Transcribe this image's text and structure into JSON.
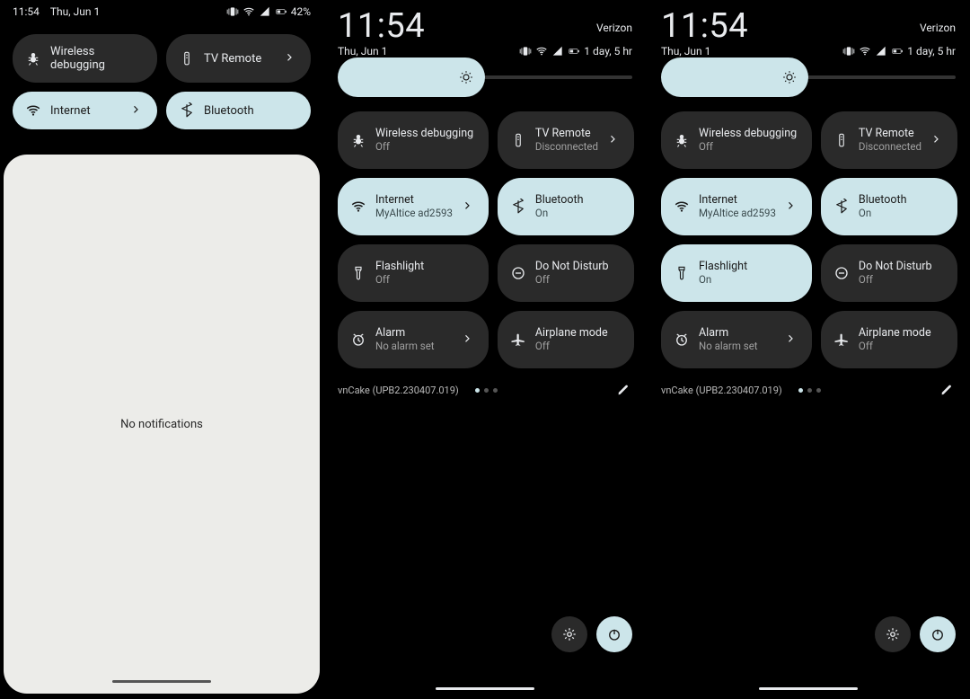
{
  "phone1": {
    "status": {
      "time": "11:54",
      "date": "Thu, Jun 1",
      "battery_percent": "42%"
    },
    "tiles": [
      {
        "id": "wireless-debugging",
        "label": "Wireless debugging",
        "style": "dark",
        "chevron": false
      },
      {
        "id": "tv-remote",
        "label": "TV Remote",
        "style": "dark",
        "chevron": true
      },
      {
        "id": "internet",
        "label": "Internet",
        "style": "accent",
        "chevron": true
      },
      {
        "id": "bluetooth",
        "label": "Bluetooth",
        "style": "accent",
        "chevron": false
      }
    ],
    "panel_text": "No notifications"
  },
  "phone2": {
    "time": "11:54",
    "carrier": "Verizon",
    "date": "Thu, Jun 1",
    "battery_note": "1 day, 5 hr",
    "tiles": [
      {
        "id": "wireless-debugging",
        "label": "Wireless debugging",
        "sub": "Off",
        "style": "dark",
        "chevron": false
      },
      {
        "id": "tv-remote",
        "label": "TV Remote",
        "sub": "Disconnected",
        "style": "dark",
        "chevron": true
      },
      {
        "id": "internet",
        "label": "Internet",
        "sub": "MyAltice ad2593",
        "style": "accent",
        "chevron": true
      },
      {
        "id": "bluetooth",
        "label": "Bluetooth",
        "sub": "On",
        "style": "accent",
        "chevron": false
      },
      {
        "id": "flashlight",
        "label": "Flashlight",
        "sub": "Off",
        "style": "dark",
        "chevron": false
      },
      {
        "id": "dnd",
        "label": "Do Not Disturb",
        "sub": "Off",
        "style": "dark",
        "chevron": false
      },
      {
        "id": "alarm",
        "label": "Alarm",
        "sub": "No alarm set",
        "style": "dark",
        "chevron": true
      },
      {
        "id": "airplane",
        "label": "Airplane mode",
        "sub": "Off",
        "style": "dark",
        "chevron": false
      }
    ],
    "build": "vnCake (UPB2.230407.019)"
  },
  "phone3": {
    "time": "11:54",
    "carrier": "Verizon",
    "date": "Thu, Jun 1",
    "battery_note": "1 day, 5 hr",
    "tiles": [
      {
        "id": "wireless-debugging",
        "label": "Wireless debugging",
        "sub": "Off",
        "style": "dark",
        "chevron": false
      },
      {
        "id": "tv-remote",
        "label": "TV Remote",
        "sub": "Disconnected",
        "style": "dark",
        "chevron": true
      },
      {
        "id": "internet",
        "label": "Internet",
        "sub": "MyAltice ad2593",
        "style": "accent",
        "chevron": true
      },
      {
        "id": "bluetooth",
        "label": "Bluetooth",
        "sub": "On",
        "style": "accent",
        "chevron": false
      },
      {
        "id": "flashlight",
        "label": "Flashlight",
        "sub": "On",
        "style": "accent",
        "chevron": false
      },
      {
        "id": "dnd",
        "label": "Do Not Disturb",
        "sub": "Off",
        "style": "dark",
        "chevron": false
      },
      {
        "id": "alarm",
        "label": "Alarm",
        "sub": "No alarm set",
        "style": "dark",
        "chevron": true
      },
      {
        "id": "airplane",
        "label": "Airplane mode",
        "sub": "Off",
        "style": "dark",
        "chevron": false
      }
    ],
    "build": "vnCake (UPB2.230407.019)"
  }
}
